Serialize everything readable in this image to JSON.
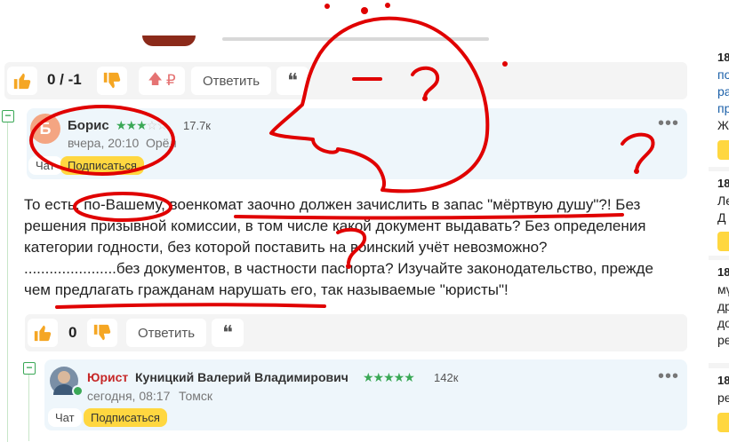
{
  "top_comment_actions": {
    "score": "0 / -1",
    "ruble_label": "₽",
    "reply_label": "Ответить",
    "quote_label": "❝"
  },
  "comment1": {
    "avatar_letter": "Б",
    "author": "Борис",
    "stars_on": "★★★",
    "stars_off": "☆☆",
    "rating": "17.7к",
    "time": "вчера, 20:10",
    "city": "Орёл",
    "chat_label": "Чат",
    "subscribe_label": "Подписаться",
    "menu_label": "•••",
    "lines": [
      "То есть, по-Вашему, военкомат заочно должен зачислить в запас \"мёртвую душу\"?! Без",
      "решения призывной комиссии, в том числе какой документ выдавать? Без определения",
      "категории годности, без которой поставить на воинский учёт невозможно?",
      "......................без документов, в частности паспорта? Изучайте законодательство, прежде",
      "чем предлагать гражданам нарушать его, так называемые \"юристы\"!"
    ],
    "actions": {
      "score": "0",
      "reply_label": "Ответить",
      "quote_label": "❝"
    }
  },
  "comment2": {
    "role": "Юрист",
    "author": "Куницкий Валерий Владимирович",
    "stars_on": "★★★★★",
    "rating": "142к",
    "time": "сегодня, 08:17",
    "city": "Томск",
    "chat_label": "Чат",
    "subscribe_label": "Подписаться",
    "menu_label": "•••"
  },
  "sidebar": {
    "items": [
      {
        "num": "18",
        "lines": [
          "по",
          "ра",
          "пр",
          "Ж"
        ]
      },
      {
        "num": "18",
        "lines": [
          "Ле",
          "Д"
        ]
      },
      {
        "num": "18",
        "lines": [
          "мү",
          "др",
          "до",
          "ре"
        ]
      },
      {
        "num": "18",
        "lines": [
          "ре"
        ]
      }
    ]
  },
  "colors": {
    "accent_yellow": "#ffd740",
    "like_orange": "#f5a623",
    "star_green": "#3aa856",
    "lawyer_red": "#c62828",
    "header_bg": "#eef6fb",
    "marker_red": "#e00000"
  },
  "icons": [
    "thumbs-up-icon",
    "thumbs-down-icon",
    "arrow-up-icon",
    "quote-icon",
    "more-dots-icon",
    "collapse-minus-icon"
  ]
}
